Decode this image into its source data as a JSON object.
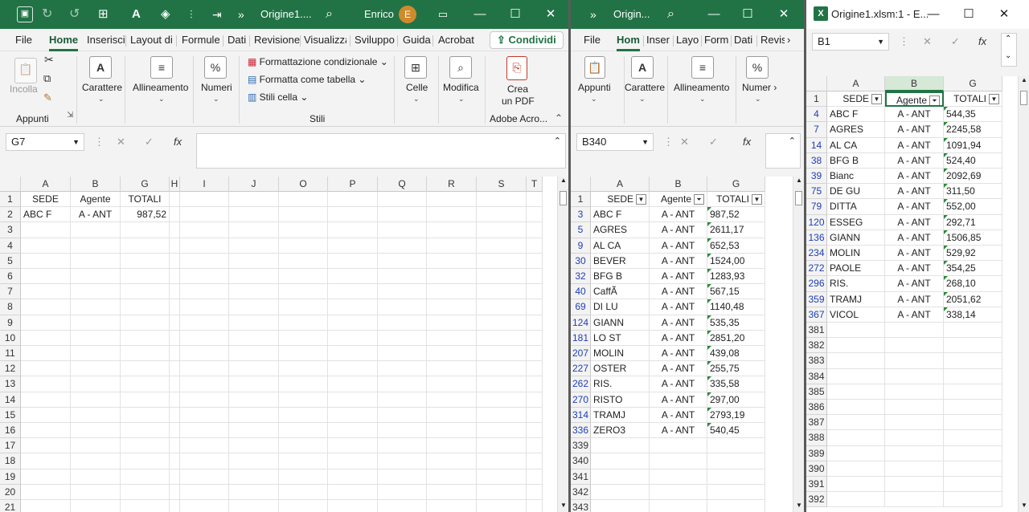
{
  "w1": {
    "title": "Origine1....",
    "user": "Enrico",
    "avatar_initial": "E",
    "tabs": [
      "File",
      "Home",
      "Inserisci",
      "Layout di",
      "Formule",
      "Dati",
      "Revisione",
      "Visualizza",
      "Sviluppo",
      "Guida",
      "Acrobat"
    ],
    "share": "Condividi",
    "ribbon": {
      "incolla": "Incolla",
      "appunti": "Appunti",
      "carattere": "Carattere",
      "allineamento": "Allineamento",
      "numeri": "Numeri",
      "fmt_cond": "Formattazione condizionale",
      "fmt_table": "Formatta come tabella",
      "stili_cella": "Stili cella",
      "stili": "Stili",
      "celle": "Celle",
      "modifica": "Modifica",
      "crea1": "Crea",
      "crea2": "un PDF",
      "adobe": "Adobe Acro..."
    },
    "namebox": "G7",
    "columns": [
      "A",
      "B",
      "G",
      "H",
      "I",
      "J",
      "O",
      "P",
      "Q",
      "R",
      "S",
      "T"
    ],
    "rows": [
      "1",
      "2",
      "3",
      "4",
      "5",
      "6",
      "7",
      "8",
      "9",
      "10",
      "11",
      "12",
      "13",
      "14",
      "15",
      "16",
      "17",
      "18",
      "19",
      "20",
      "21"
    ],
    "header_cells": [
      "SEDE",
      "Agente",
      "TOTALI"
    ],
    "row2": [
      "ABC F",
      "A - ANT",
      "987,52"
    ]
  },
  "w2": {
    "title": "Origin...",
    "tabs": [
      "File",
      "Hom",
      "Inser",
      "Layo",
      "Form",
      "Dati",
      "Revis"
    ],
    "ribbon": {
      "appunti": "Appunti",
      "carattere": "Carattere",
      "allineamento": "Allineamento",
      "numeri": "Numer"
    },
    "namebox": "B340",
    "columns": [
      "A",
      "B",
      "G"
    ],
    "header_cells": [
      "SEDE",
      "Agente",
      "TOTALI"
    ],
    "rows": [
      {
        "n": "3",
        "a": "ABC F",
        "b": "A - ANT",
        "g": "987,52",
        "hl": false
      },
      {
        "n": "5",
        "a": "AGRES",
        "b": "A - ANT",
        "g": "2611,17",
        "hl": false
      },
      {
        "n": "9",
        "a": "AL CA",
        "b": "A - ANT",
        "g": "652,53",
        "hl": false
      },
      {
        "n": "30",
        "a": "BEVER",
        "b": "A - ANT",
        "g": "1524,00",
        "hl": true
      },
      {
        "n": "32",
        "a": "BFG B",
        "b": "A - ANT",
        "g": "1283,93",
        "hl": true
      },
      {
        "n": "40",
        "a": "CaffÃ",
        "b": "A - ANT",
        "g": "567,15",
        "hl": true
      },
      {
        "n": "69",
        "a": "DI LU",
        "b": "A - ANT",
        "g": "1140,48",
        "hl": false
      },
      {
        "n": "124",
        "a": "GIANN",
        "b": "A - ANT",
        "g": "535,35",
        "hl": true
      },
      {
        "n": "181",
        "a": "LO ST",
        "b": "A - ANT",
        "g": "2851,20",
        "hl": false
      },
      {
        "n": "207",
        "a": "MOLIN",
        "b": "A - ANT",
        "g": "439,08",
        "hl": false
      },
      {
        "n": "227",
        "a": "OSTER",
        "b": "A - ANT",
        "g": "255,75",
        "hl": false
      },
      {
        "n": "262",
        "a": "RIS.",
        "b": "A - ANT",
        "g": "335,58",
        "hl": true
      },
      {
        "n": "270",
        "a": "RISTO",
        "b": "A - ANT",
        "g": "297,00",
        "hl": true
      },
      {
        "n": "314",
        "a": "TRAMJ",
        "b": "A - ANT",
        "g": "2793,19",
        "hl": true
      },
      {
        "n": "336",
        "a": "ZERO3",
        "b": "A - ANT",
        "g": "540,45",
        "hl": true
      }
    ],
    "empty_rows": [
      "339",
      "340",
      "341",
      "342",
      "343"
    ]
  },
  "w3": {
    "title": "Origine1.xlsm:1 - E...",
    "namebox": "B1",
    "columns": [
      "A",
      "B",
      "G"
    ],
    "header_cells": [
      "SEDE",
      "Agente",
      "TOTALI"
    ],
    "rows": [
      {
        "n": "4",
        "a": "ABC F",
        "b": "A - ANT",
        "g": "544,35"
      },
      {
        "n": "7",
        "a": "AGRES",
        "b": "A - ANT",
        "g": "2245,58"
      },
      {
        "n": "14",
        "a": "AL CA",
        "b": "A - ANT",
        "g": "1091,94"
      },
      {
        "n": "38",
        "a": "BFG B",
        "b": "A - ANT",
        "g": "524,40"
      },
      {
        "n": "39",
        "a": "Bianc",
        "b": "A - ANT",
        "g": "2092,69"
      },
      {
        "n": "75",
        "a": "DE GU",
        "b": "A - ANT",
        "g": "311,50"
      },
      {
        "n": "79",
        "a": "DITTA",
        "b": "A - ANT",
        "g": "552,00"
      },
      {
        "n": "120",
        "a": "ESSEG",
        "b": "A - ANT",
        "g": "292,71"
      },
      {
        "n": "136",
        "a": "GIANN",
        "b": "A - ANT",
        "g": "1506,85"
      },
      {
        "n": "234",
        "a": "MOLIN",
        "b": "A - ANT",
        "g": "529,92"
      },
      {
        "n": "272",
        "a": "PAOLE",
        "b": "A - ANT",
        "g": "354,25"
      },
      {
        "n": "296",
        "a": "RIS.",
        "b": "A - ANT",
        "g": "268,10"
      },
      {
        "n": "359",
        "a": "TRAMJ",
        "b": "A - ANT",
        "g": "2051,62"
      },
      {
        "n": "367",
        "a": "VICOL",
        "b": "A - ANT",
        "g": "338,14"
      }
    ],
    "empty_rows": [
      "381",
      "382",
      "383",
      "384",
      "385",
      "386",
      "387",
      "388",
      "389",
      "390",
      "391",
      "392"
    ]
  },
  "colors": {
    "excel_green": "#217346",
    "highlight": "#e2efd9",
    "row_number_blue": "#1f3fb5"
  }
}
